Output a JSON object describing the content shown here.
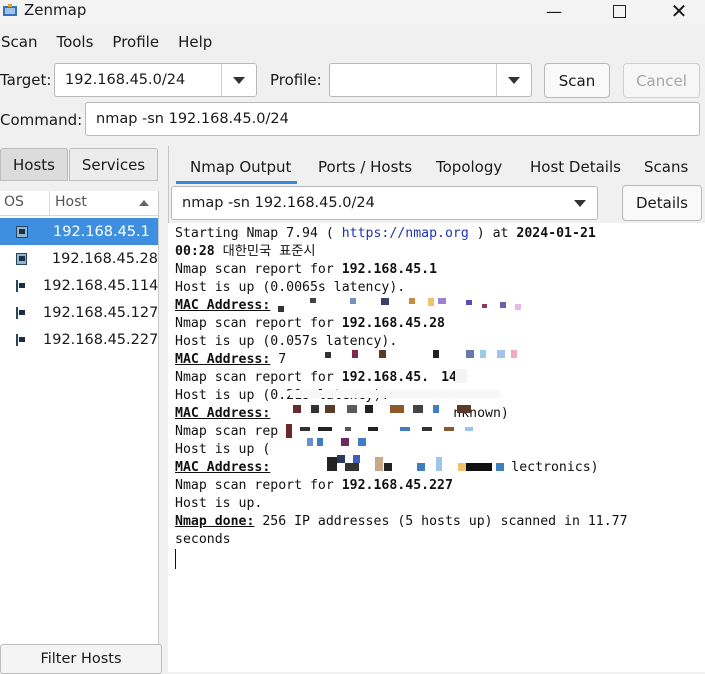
{
  "window": {
    "title": "Zenmap",
    "controls": [
      "minimize-icon",
      "maximize-icon",
      "close-icon"
    ]
  },
  "menu": [
    "Scan",
    "Tools",
    "Profile",
    "Help"
  ],
  "toolbar": {
    "target_label": "Target:",
    "target_value": "192.168.45.0/24",
    "profile_label": "Profile:",
    "profile_value": "",
    "scan_button": "Scan",
    "cancel_button": "Cancel",
    "command_label": "Command:",
    "command_value": "nmap -sn 192.168.45.0/24"
  },
  "left": {
    "tabs": [
      "Hosts",
      "Services"
    ],
    "col_os": "OS",
    "col_host": "Host",
    "hosts": [
      "192.168.45.1",
      "192.168.45.28",
      "192.168.45.114",
      "192.168.45.127",
      "192.168.45.227"
    ],
    "filter_button": "Filter Hosts"
  },
  "right": {
    "tabs": [
      "Nmap Output",
      "Ports / Hosts",
      "Topology",
      "Host Details",
      "Scans"
    ],
    "command_select": "nmap -sn 192.168.45.0/24",
    "details_button": "Details"
  },
  "output": {
    "l1a": "Starting Nmap 7.94 ( ",
    "l1url": "https://nmap.org",
    "l1b": " ) at ",
    "l1date": "2024-01-21",
    "l2a": "00:28",
    "l2b": " 대한민국 표준시",
    "report_prefix": "Nmap scan report for ",
    "r1_ip": "192.168.45.1",
    "r1_up": "Host is up (0.0065s latency).",
    "mac_label": "MAC Address:",
    "r2_ip": "192.168.45.28",
    "r2_up": "Host is up (0.057s latency).",
    "r2_mac_partial": " 7",
    "r3_ip_partial": "192.168.45.",
    "r3_ip_tail": "14",
    "r3_up_partial": "Host is up (0.21s latency).",
    "r3_mac_tail": "nknown)",
    "r4_report_partial": "Nmap scan rep",
    "r4_up_partial": "Host is up (",
    "r4_mac_tail": "lectronics)",
    "r5_ip": "192.168.45.227",
    "r5_up": "Host is up.",
    "done_label": "Nmap done:",
    "done_text": " 256 IP addresses (5 hosts up) scanned in 11.77",
    "done_text2": "seconds"
  }
}
